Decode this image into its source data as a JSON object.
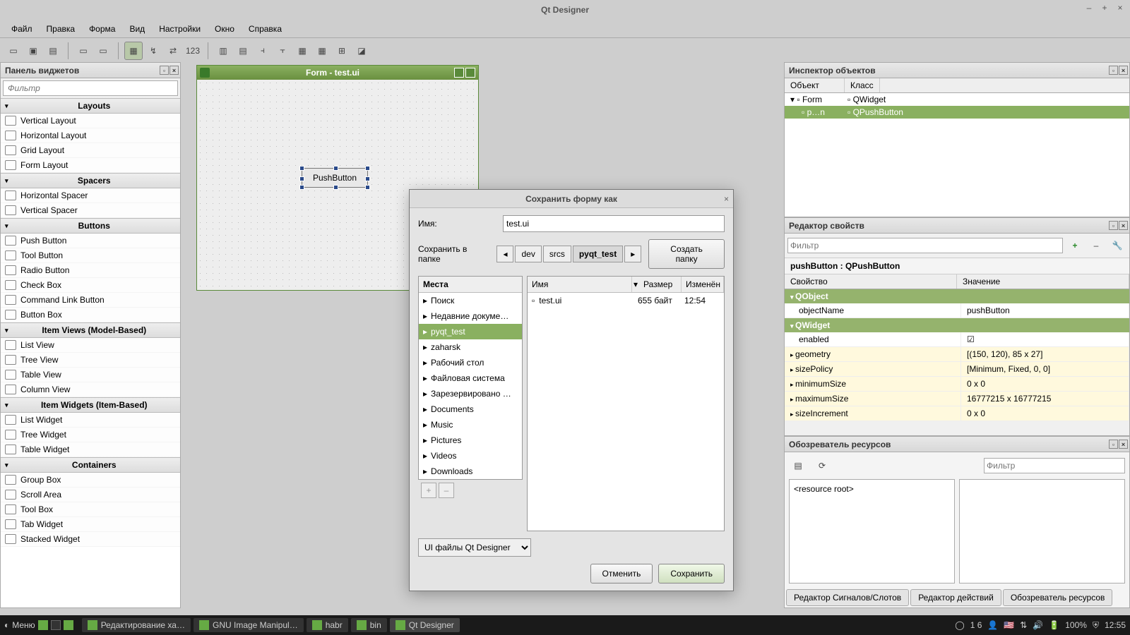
{
  "app": {
    "title": "Qt Designer"
  },
  "menu": [
    "Файл",
    "Правка",
    "Форма",
    "Вид",
    "Настройки",
    "Окно",
    "Справка"
  ],
  "widgetbox": {
    "title": "Панель виджетов",
    "filter": "Фильтр",
    "cats": [
      {
        "name": "Layouts",
        "items": [
          "Vertical Layout",
          "Horizontal Layout",
          "Grid Layout",
          "Form Layout"
        ]
      },
      {
        "name": "Spacers",
        "items": [
          "Horizontal Spacer",
          "Vertical Spacer"
        ]
      },
      {
        "name": "Buttons",
        "items": [
          "Push Button",
          "Tool Button",
          "Radio Button",
          "Check Box",
          "Command Link Button",
          "Button Box"
        ]
      },
      {
        "name": "Item Views (Model-Based)",
        "items": [
          "List View",
          "Tree View",
          "Table View",
          "Column View"
        ]
      },
      {
        "name": "Item Widgets (Item-Based)",
        "items": [
          "List Widget",
          "Tree Widget",
          "Table Widget"
        ]
      },
      {
        "name": "Containers",
        "items": [
          "Group Box",
          "Scroll Area",
          "Tool Box",
          "Tab Widget",
          "Stacked Widget"
        ]
      }
    ]
  },
  "form": {
    "title": "Form - test.ui",
    "button": "PushButton"
  },
  "inspector": {
    "title": "Инспектор объектов",
    "cols": [
      "Объект",
      "Класс"
    ],
    "rows": [
      {
        "obj": "Form",
        "cls": "QWidget",
        "sel": false
      },
      {
        "obj": "p…n",
        "cls": "QPushButton",
        "sel": true
      }
    ]
  },
  "props": {
    "title": "Редактор свойств",
    "filter": "Фильтр",
    "obj": "pushButton : QPushButton",
    "cols": [
      "Свойство",
      "Значение"
    ],
    "groups": [
      {
        "name": "QObject",
        "rows": [
          {
            "k": "objectName",
            "v": "pushButton",
            "y": false,
            "e": false
          }
        ]
      },
      {
        "name": "QWidget",
        "rows": [
          {
            "k": "enabled",
            "v": "☑",
            "y": false,
            "e": false
          },
          {
            "k": "geometry",
            "v": "[(150, 120), 85 x 27]",
            "y": true,
            "e": true
          },
          {
            "k": "sizePolicy",
            "v": "[Minimum, Fixed, 0, 0]",
            "y": true,
            "e": true
          },
          {
            "k": "minimumSize",
            "v": "0 x 0",
            "y": true,
            "e": true
          },
          {
            "k": "maximumSize",
            "v": "16777215 x 16777215",
            "y": true,
            "e": true
          },
          {
            "k": "sizeIncrement",
            "v": "0 x 0",
            "y": true,
            "e": true
          }
        ]
      }
    ]
  },
  "resources": {
    "title": "Обозреватель ресурсов",
    "filter": "Фильтр",
    "root": "<resource root>",
    "tabs": [
      "Редактор Сигналов/Слотов",
      "Редактор действий",
      "Обозреватель ресурсов"
    ]
  },
  "dialog": {
    "title": "Сохранить форму как",
    "name_label": "Имя:",
    "name_value": "test.ui",
    "folder_label": "Сохранить в папке",
    "crumbs": [
      "dev",
      "srcs",
      "pyqt_test"
    ],
    "create_folder": "Создать папку",
    "places_hdr": "Места",
    "places": [
      "Поиск",
      "Недавние докуме…",
      "pyqt_test",
      "zaharsk",
      "Рабочий стол",
      "Файловая система",
      "Зарезервировано …",
      "Documents",
      "Music",
      "Pictures",
      "Videos",
      "Downloads"
    ],
    "place_sel": 2,
    "fl_cols": [
      "Имя",
      "Размер",
      "Изменён"
    ],
    "files": [
      {
        "n": "test.ui",
        "s": "655 байт",
        "m": "12:54"
      }
    ],
    "filetype": "UI файлы Qt Designer",
    "cancel": "Отменить",
    "save": "Сохранить"
  },
  "taskbar": {
    "menu": "Меню",
    "tasks": [
      "Редактирование ха…",
      "GNU Image Manipul…",
      "habr",
      "bin",
      "Qt Designer"
    ],
    "active": 4,
    "battery": "100%",
    "time": "12:55",
    "notif": "1 6"
  }
}
